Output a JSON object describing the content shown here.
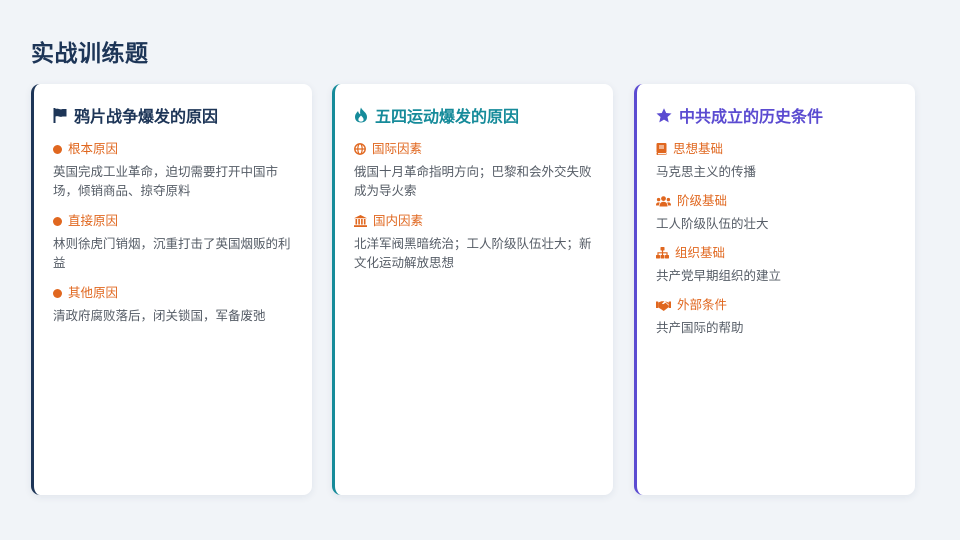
{
  "page": {
    "title": "实战训练题"
  },
  "cards": [
    {
      "title": "鸦片战争爆发的原因",
      "icon": "flag-icon",
      "accent": "#1d3557",
      "sections": [
        {
          "label": "根本原因",
          "icon": "bullet-dot-icon",
          "text": "英国完成工业革命，迫切需要打开中国市场，倾销商品、掠夺原料"
        },
        {
          "label": "直接原因",
          "icon": "bullet-dot-icon",
          "text": "林则徐虎门销烟，沉重打击了英国烟贩的利益"
        },
        {
          "label": "其他原因",
          "icon": "bullet-dot-icon",
          "text": "清政府腐败落后，闭关锁国，军备废弛"
        }
      ]
    },
    {
      "title": "五四运动爆发的原因",
      "icon": "fire-icon",
      "accent": "#168b9a",
      "sections": [
        {
          "label": "国际因素",
          "icon": "globe-icon",
          "text": "俄国十月革命指明方向；巴黎和会外交失败成为导火索"
        },
        {
          "label": "国内因素",
          "icon": "landmark-icon",
          "text": "北洋军阀黑暗统治；工人阶级队伍壮大；新文化运动解放思想"
        }
      ]
    },
    {
      "title": "中共成立的历史条件",
      "icon": "star-icon",
      "accent": "#5b4bd1",
      "sections": [
        {
          "label": "思想基础",
          "icon": "book-icon",
          "text": "马克思主义的传播"
        },
        {
          "label": "阶级基础",
          "icon": "users-icon",
          "text": "工人阶级队伍的壮大"
        },
        {
          "label": "组织基础",
          "icon": "sitemap-icon",
          "text": "共产党早期组织的建立"
        },
        {
          "label": "外部条件",
          "icon": "handshake-icon",
          "text": "共产国际的帮助"
        }
      ]
    }
  ],
  "colors": {
    "section_label": "#e0671f",
    "body_text": "#555c66",
    "background": "#f1f4f8"
  }
}
